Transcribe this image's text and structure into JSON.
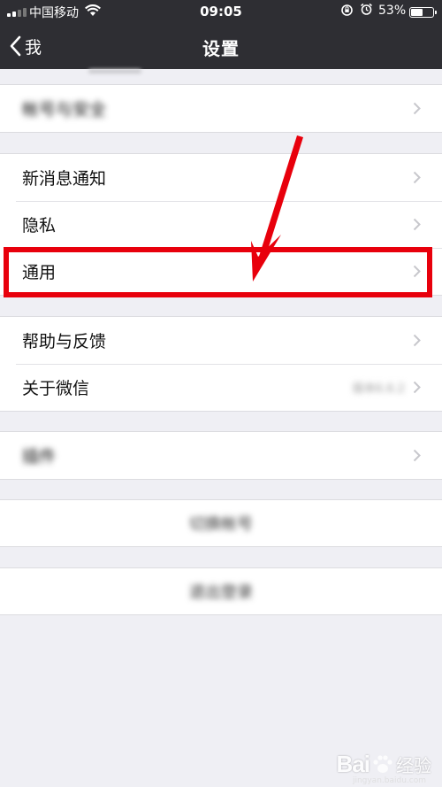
{
  "status_bar": {
    "carrier": "中国移动",
    "time": "09:05",
    "battery": "53%"
  },
  "nav": {
    "back_label": "我",
    "title": "设置"
  },
  "groups": {
    "account": {
      "label": "帐号与安全"
    },
    "main": [
      {
        "label": "新消息通知"
      },
      {
        "label": "隐私"
      },
      {
        "label": "通用"
      }
    ],
    "help": [
      {
        "label": "帮助与反馈"
      },
      {
        "label": "关于微信",
        "value": "版本6.6.2"
      }
    ],
    "plugin": {
      "label": "插件"
    },
    "switch_account": {
      "label": "切换帐号"
    },
    "logout": {
      "label": "退出登录"
    }
  },
  "annotation": {
    "highlight_color": "#e8000c"
  },
  "watermark": {
    "text": "Bai",
    "sub": "经验",
    "url": "jingyan.baidu.com"
  },
  "colors": {
    "bar": "#2e2e33",
    "bg": "#efeff4",
    "accent": "#e8000c"
  }
}
